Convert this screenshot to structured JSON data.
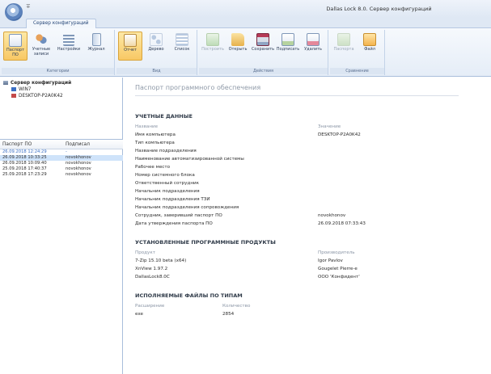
{
  "window": {
    "title": "Dallas Lock 8.0. Сервер конфигураций",
    "quick_access": "∓",
    "tab": "Сервер конфигураций"
  },
  "ribbon": {
    "groups": [
      {
        "label": "Категории",
        "buttons": [
          {
            "label": "Паспорт ПО",
            "icon": "passport-icon",
            "state": "active"
          },
          {
            "label": "Учетные записи",
            "icon": "users-icon",
            "state": "normal"
          },
          {
            "label": "Настройки",
            "icon": "settings-icon",
            "state": "normal"
          },
          {
            "label": "Журнал",
            "icon": "journal-icon",
            "state": "normal"
          }
        ]
      },
      {
        "label": "Вид",
        "buttons": [
          {
            "label": "Отчет",
            "icon": "report-icon",
            "state": "active"
          },
          {
            "label": "Дерево",
            "icon": "tree-icon",
            "state": "normal"
          },
          {
            "label": "Список",
            "icon": "list-icon",
            "state": "normal"
          }
        ]
      },
      {
        "label": "Действия",
        "buttons": [
          {
            "label": "Построить",
            "icon": "build-icon",
            "state": "disabled"
          },
          {
            "label": "Открыть",
            "icon": "open-folder-icon",
            "state": "normal"
          },
          {
            "label": "Сохранить",
            "icon": "save-icon",
            "state": "normal"
          },
          {
            "label": "Подписать",
            "icon": "sign-icon",
            "state": "normal"
          },
          {
            "label": "Удалить",
            "icon": "delete-icon",
            "state": "normal"
          }
        ]
      },
      {
        "label": "Сравнение",
        "buttons": [
          {
            "label": "Паспорта",
            "icon": "passports-icon",
            "state": "disabled"
          },
          {
            "label": "Файл",
            "icon": "file-icon",
            "state": "normal"
          }
        ]
      }
    ]
  },
  "tree": {
    "root": "Сервер конфигураций",
    "children": [
      "WIN7",
      "DESKTOP-P2A0K42"
    ]
  },
  "passport_list": {
    "headers": [
      "Паспорт ПО",
      "Подписал"
    ],
    "rows": [
      {
        "date": "26.09.2018 12:24:29",
        "signer": "-",
        "state": "draft"
      },
      {
        "date": "26.09.2018 10:33:25",
        "signer": "novokhonov",
        "state": "selected"
      },
      {
        "date": "26.09.2018 10:09:40",
        "signer": "novokhonov",
        "state": "normal"
      },
      {
        "date": "25.09.2018 17:40:37",
        "signer": "novokhonov",
        "state": "normal"
      },
      {
        "date": "25.09.2018 17:23:29",
        "signer": "novokhonov",
        "state": "normal"
      }
    ]
  },
  "document": {
    "title": "Паспорт программного обеспечения",
    "accounts": {
      "heading": "УЧЕТНЫЕ ДАННЫЕ",
      "col_name": "Название",
      "col_value": "Значение",
      "rows": [
        {
          "name": "Имя компьютера",
          "value": "DESKTOP-P2A0K42"
        },
        {
          "name": "Тип компьютера",
          "value": ""
        },
        {
          "name": "Название подразделения",
          "value": ""
        },
        {
          "name": "Наименование автоматизированной системы",
          "value": ""
        },
        {
          "name": "Рабочее место",
          "value": ""
        },
        {
          "name": "Номер системного блока",
          "value": ""
        },
        {
          "name": "Ответственный сотрудник",
          "value": ""
        },
        {
          "name": "Начальник подразделения",
          "value": ""
        },
        {
          "name": "Начальник подразделения ТЗИ",
          "value": ""
        },
        {
          "name": "Начальник подразделения сопровождения",
          "value": ""
        },
        {
          "name": "Сотрудник, заверивший паспорт ПО",
          "value": "novokhonov"
        },
        {
          "name": "Дата утверждения паспорта ПО",
          "value": "26.09.2018 07:33:43"
        }
      ]
    },
    "software": {
      "heading": "УСТАНОВЛЕННЫЕ ПРОГРАММНЫЕ ПРОДУКТЫ",
      "col_product": "Продукт",
      "col_vendor": "Производитель",
      "rows": [
        {
          "product": "7-Zip 15.10 beta (x64)",
          "vendor": "Igor Pavlov"
        },
        {
          "product": "XnView 1.97.2",
          "vendor": "Gougelet Pierre-e"
        },
        {
          "product": "DallasLock8.0C",
          "vendor": "ООО 'Конфидент'"
        }
      ]
    },
    "executables": {
      "heading": "ИСПОЛНЯЕМЫЕ ФАЙЛЫ ПО ТИПАМ",
      "col_ext": "Расширение",
      "col_count": "Количество",
      "rows": [
        {
          "ext": "exe",
          "count": "2854"
        }
      ]
    }
  }
}
